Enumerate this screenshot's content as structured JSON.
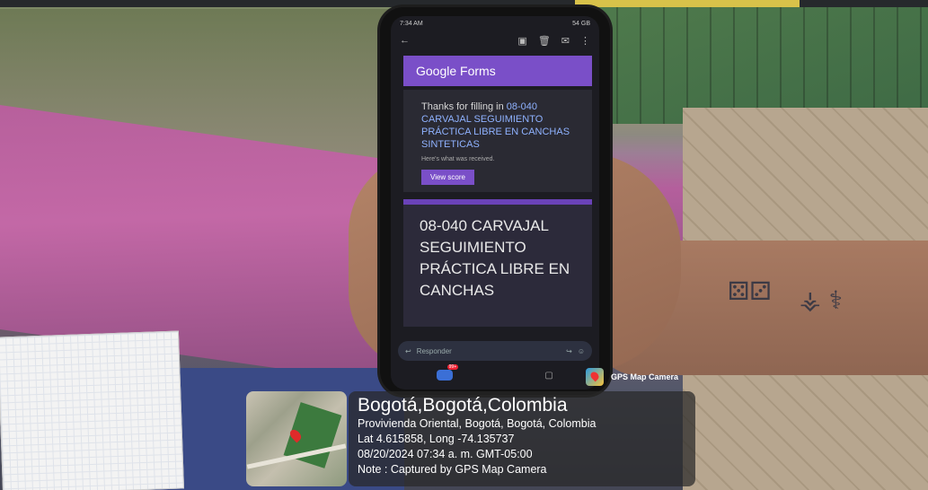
{
  "phone": {
    "status_time": "7:34 AM",
    "status_right": "54 GB",
    "banner": "Google Forms",
    "thanks_prefix": "Thanks for filling in ",
    "thanks_title": "08-040 CARVAJAL SEGUIMIENTO PRÁCTICA LIBRE EN CANCHAS SINTETICAS",
    "received": "Here's what was received.",
    "view_score": "View score",
    "form_title": "08-040 CARVAJAL SEGUIMIENTO PRÁCTICA LIBRE EN CANCHAS",
    "reply_placeholder": "Responder",
    "mail_badge": "99+"
  },
  "gps": {
    "app_label": "GPS Map Camera",
    "city": "Bogotá,Bogotá,Colombia",
    "address": "Provivienda Oriental, Bogotá, Bogotá, Colombia",
    "coords": "Lat 4.615858, Long -74.135737",
    "datetime": "08/20/2024 07:34 a. m. GMT-05:00",
    "note": "Note : Captured by GPS Map Camera"
  },
  "icons": [
    "back-arrow-icon",
    "archive-icon",
    "trash-icon",
    "mail-icon",
    "more-icon",
    "reply-icon",
    "forward-icon",
    "emoji-icon",
    "map-pin-icon"
  ]
}
